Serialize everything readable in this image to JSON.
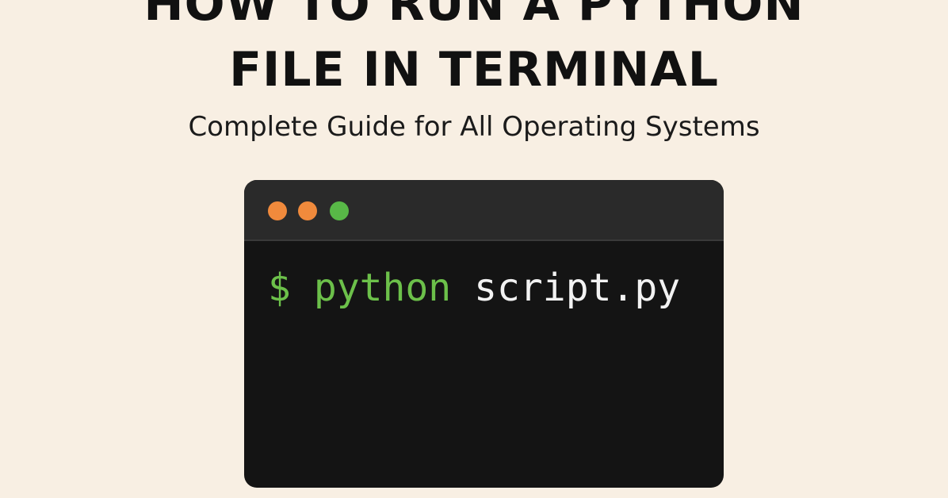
{
  "title": {
    "line1": "HOW TO RUN A PYTHON",
    "line2": "FILE IN TERMINAL"
  },
  "subtitle": "Complete Guide for All Operating Systems",
  "terminal": {
    "dots": [
      {
        "name": "orange-dot",
        "color": "#f08a3c"
      },
      {
        "name": "orange-dot",
        "color": "#f08a3c"
      },
      {
        "name": "green-dot",
        "color": "#58b847"
      }
    ],
    "prompt": "$",
    "command": "python",
    "argument": "script.py",
    "colors": {
      "window": "#141414",
      "titlebar": "#2a2a2a",
      "command_green": "#6cc04a",
      "argument_white": "#f2f2f2"
    }
  },
  "colors": {
    "background": "#f8efe3",
    "title": "#111111"
  }
}
